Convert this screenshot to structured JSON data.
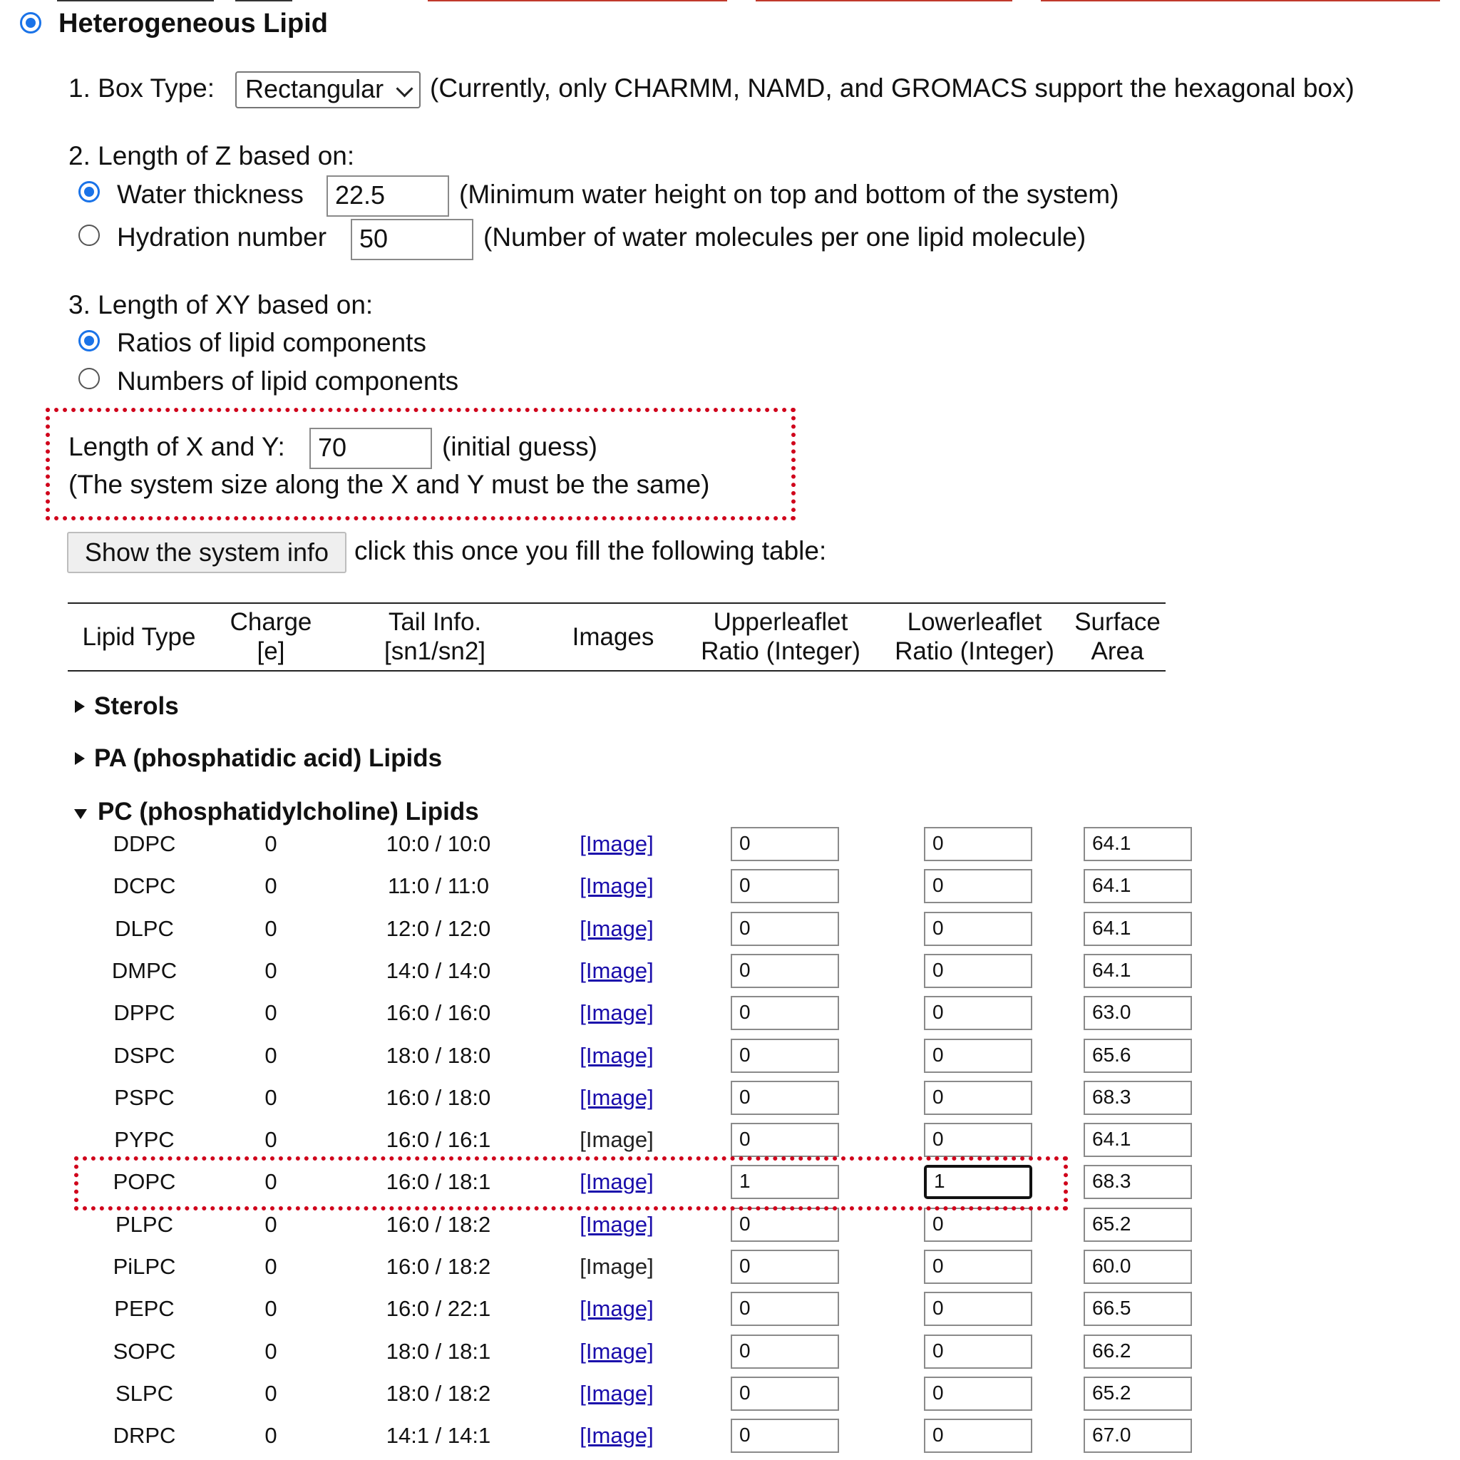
{
  "heading": "Heterogeneous Lipid",
  "box_type": {
    "label": "1. Box Type:",
    "value": "Rectangular",
    "note": "(Currently, only CHARMM, NAMD, and GROMACS support the hexagonal box)"
  },
  "z_length": {
    "label": "2. Length of Z based on:",
    "water_label": "Water thickness",
    "water_value": "22.5",
    "water_note": "(Minimum water height on top and bottom of the system)",
    "hydration_label": "Hydration number",
    "hydration_value": "50",
    "hydration_note": "(Number of water molecules per one lipid molecule)"
  },
  "xy_length": {
    "label": "3. Length of XY based on:",
    "ratio_label": "Ratios of lipid components",
    "number_label": "Numbers of lipid components",
    "xy_label": "Length of X and Y:",
    "xy_value": "70",
    "xy_note": "(initial guess)",
    "xy_constraint": "(The system size along the X and Y must be the same)"
  },
  "system_info": {
    "button": "Show the system info",
    "hint": "click this once you fill the following table:"
  },
  "table": {
    "headers": {
      "lipid_type": "Lipid Type",
      "charge_1": "Charge",
      "charge_2": "[e]",
      "tail_1": "Tail Info.",
      "tail_2": "[sn1/sn2]",
      "images": "Images",
      "upper_1": "Upperleaflet",
      "upper_2": "Ratio (Integer)",
      "lower_1": "Lowerleaflet",
      "lower_2": "Ratio (Integer)",
      "area_1": "Surface",
      "area_2": "Area"
    },
    "sections": [
      "Sterols",
      "PA (phosphatidic acid) Lipids",
      "PC (phosphatidylcholine) Lipids"
    ],
    "rows": [
      {
        "name": "DDPC",
        "charge": "0",
        "tail": "10:0 / 10:0",
        "image": "[Image]",
        "upper": "0",
        "lower": "0",
        "area": "64.1"
      },
      {
        "name": "DCPC",
        "charge": "0",
        "tail": "11:0 / 11:0",
        "image": "[Image]",
        "upper": "0",
        "lower": "0",
        "area": "64.1"
      },
      {
        "name": "DLPC",
        "charge": "0",
        "tail": "12:0 / 12:0",
        "image": "[Image]",
        "upper": "0",
        "lower": "0",
        "area": "64.1"
      },
      {
        "name": "DMPC",
        "charge": "0",
        "tail": "14:0 / 14:0",
        "image": "[Image]",
        "upper": "0",
        "lower": "0",
        "area": "64.1"
      },
      {
        "name": "DPPC",
        "charge": "0",
        "tail": "16:0 / 16:0",
        "image": "[Image]",
        "upper": "0",
        "lower": "0",
        "area": "63.0"
      },
      {
        "name": "DSPC",
        "charge": "0",
        "tail": "18:0 / 18:0",
        "image": "[Image]",
        "upper": "0",
        "lower": "0",
        "area": "65.6"
      },
      {
        "name": "PSPC",
        "charge": "0",
        "tail": "16:0 / 18:0",
        "image": "[Image]",
        "upper": "0",
        "lower": "0",
        "area": "68.3"
      },
      {
        "name": "PYPC",
        "charge": "0",
        "tail": "16:0 / 16:1",
        "image": "[Image]",
        "upper": "0",
        "lower": "0",
        "area": "64.1"
      },
      {
        "name": "POPC",
        "charge": "0",
        "tail": "16:0 / 18:1",
        "image": "[Image]",
        "upper": "1",
        "lower": "1",
        "area": "68.3"
      },
      {
        "name": "PLPC",
        "charge": "0",
        "tail": "16:0 / 18:2",
        "image": "[Image]",
        "upper": "0",
        "lower": "0",
        "area": "65.2"
      },
      {
        "name": "PiLPC",
        "charge": "0",
        "tail": "16:0 / 18:2",
        "image": "[Image]",
        "upper": "0",
        "lower": "0",
        "area": "60.0"
      },
      {
        "name": "PEPC",
        "charge": "0",
        "tail": "16:0 / 22:1",
        "image": "[Image]",
        "upper": "0",
        "lower": "0",
        "area": "66.5"
      },
      {
        "name": "SOPC",
        "charge": "0",
        "tail": "18:0 / 18:1",
        "image": "[Image]",
        "upper": "0",
        "lower": "0",
        "area": "66.2"
      },
      {
        "name": "SLPC",
        "charge": "0",
        "tail": "18:0 / 18:2",
        "image": "[Image]",
        "upper": "0",
        "lower": "0",
        "area": "65.2"
      },
      {
        "name": "DRPC",
        "charge": "0",
        "tail": "14:1 / 14:1",
        "image": "[Image]",
        "upper": "0",
        "lower": "0",
        "area": "67.0"
      }
    ]
  }
}
